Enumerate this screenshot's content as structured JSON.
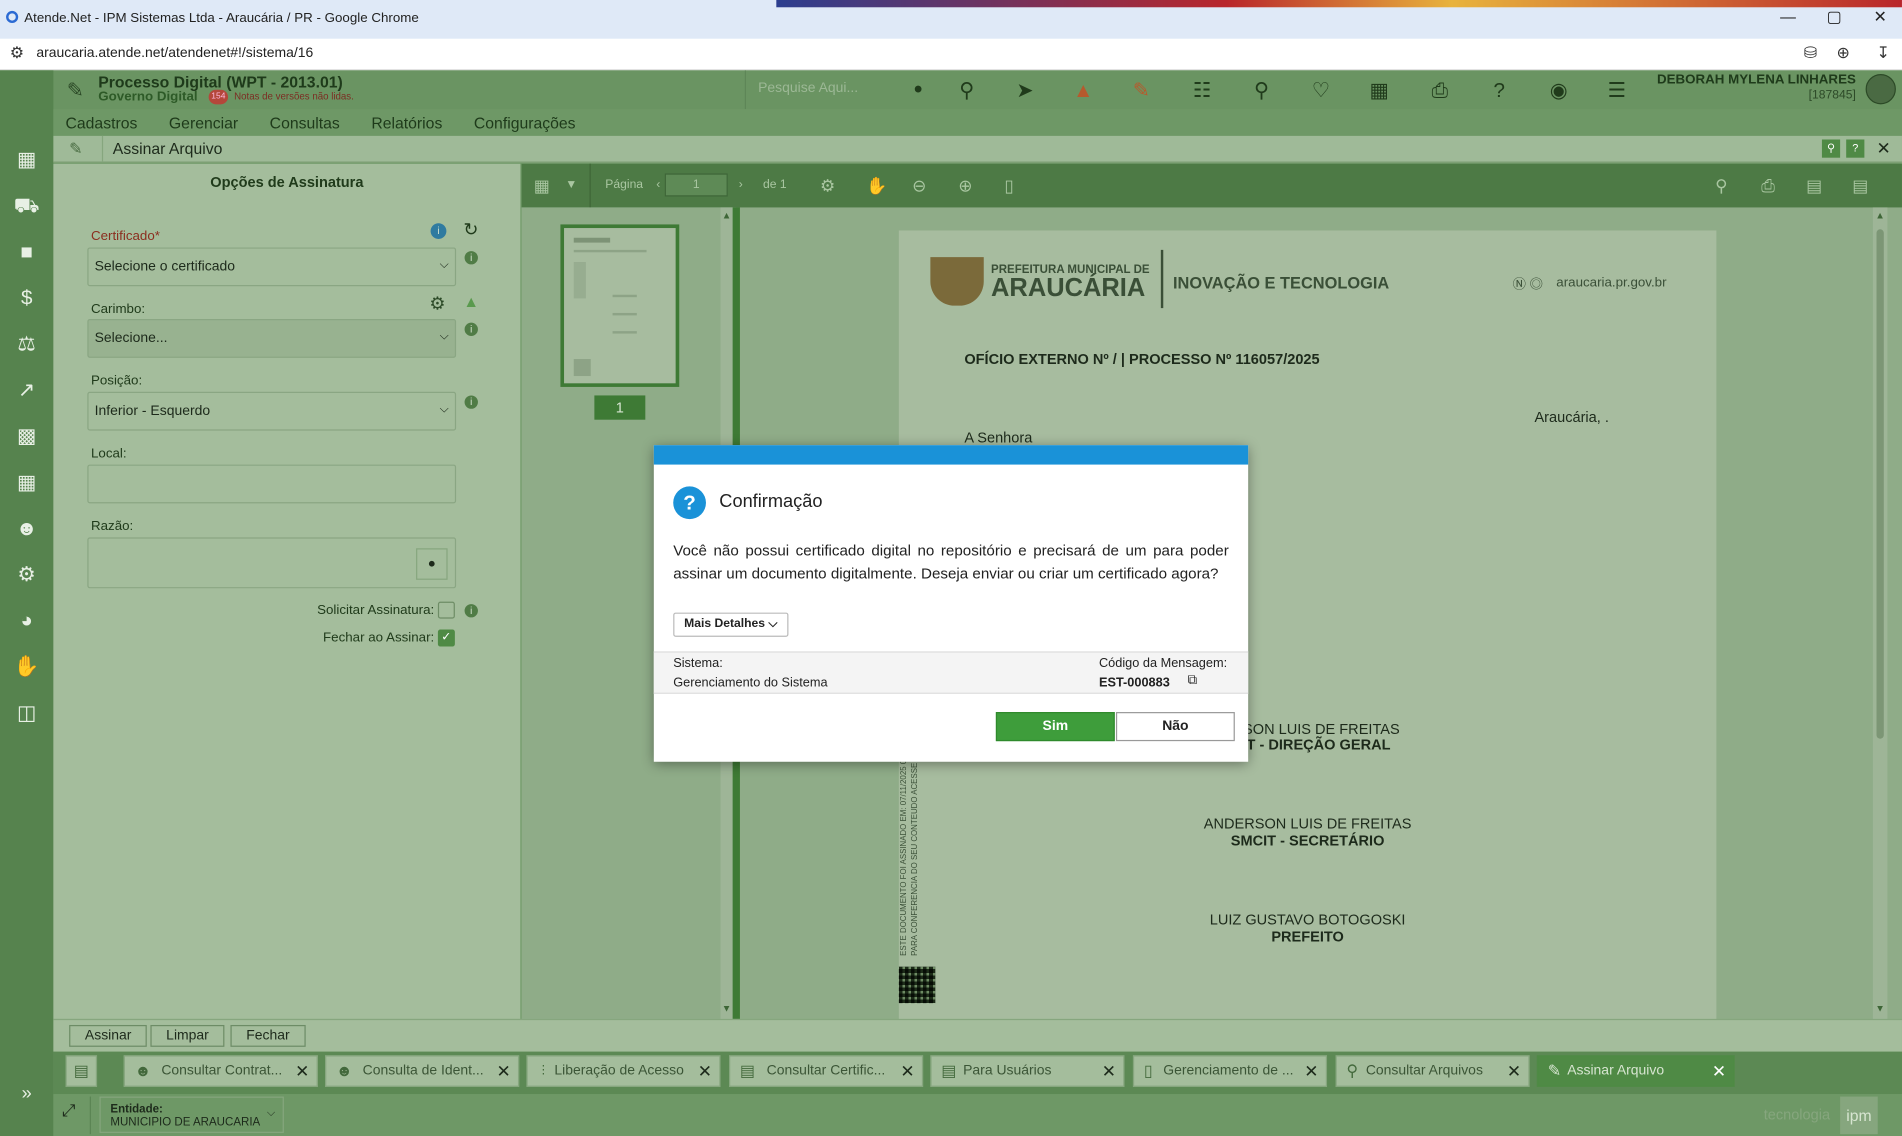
{
  "browser": {
    "title": "Atende.Net - IPM Sistemas Ltda - Araucária / PR - Google Chrome",
    "url": "araucaria.atende.net/atendenet#!/sistema/16"
  },
  "header": {
    "logo": "ipm",
    "app_title": "Processo Digital (WPT - 2013.01)",
    "app_subtitle": "Governo Digital",
    "notes_badge": "154",
    "notes_label": "Notas de versões não lidas.",
    "search_placeholder": "Pesquise Aqui...",
    "user_name": "DEBORAH MYLENA LINHARES",
    "user_id": "[187845]"
  },
  "menu": [
    "Cadastros",
    "Gerenciar",
    "Consultas",
    "Relatórios",
    "Configurações"
  ],
  "window": {
    "title": "Assinar Arquivo"
  },
  "sign_options": {
    "heading": "Opções de Assinatura",
    "certificado_label": "Certificado*",
    "certificado_value": "Selecione o certificado",
    "carimbo_label": "Carimbo:",
    "carimbo_value": "Selecione...",
    "posicao_label": "Posição:",
    "posicao_value": "Inferior - Esquerdo",
    "local_label": "Local:",
    "razao_label": "Razão:",
    "solicitar_label": "Solicitar Assinatura:",
    "solicitar_checked": false,
    "fechar_label": "Fechar ao Assinar:",
    "fechar_checked": true
  },
  "viewer": {
    "page_label": "Página",
    "page_value": "1",
    "page_total": "de 1",
    "thumb_number": "1"
  },
  "document": {
    "org_line1": "PREFEITURA MUNICIPAL DE",
    "org_line2": "ARAUCÁRIA",
    "dept": "INOVAÇÃO E TECNOLOGIA",
    "site": "araucaria.pr.gov.br",
    "heading": "OFÍCIO EXTERNO Nº / | PROCESSO Nº 116057/2025",
    "city_date": "Araucária, .",
    "salutation": "A Senhora",
    "sig1_name": "ERSON LUIS DE FREITAS",
    "sig1_role": "CIT - DIREÇÃO GERAL",
    "sig2_name": "ANDERSON LUIS DE FREITAS",
    "sig2_role": "SMCIT - SECRETÁRIO",
    "sig3_name": "LUIZ GUSTAVO BOTOGOSKI",
    "sig3_role": "PREFEITO",
    "side_note1": "ESTE DOCUMENTO FOI ASSINADO EM: 07/11/2025 09",
    "side_note2": "PARA CONFERÊNCIA DO SEU CONTEÚDO ACESSE"
  },
  "dialog": {
    "title": "Confirmação",
    "message": "Você não possui certificado digital no repositório e precisará de um para poder assinar um documento digitalmente. Deseja enviar ou criar um certificado agora?",
    "details_button": "Mais Detalhes",
    "sistema_label": "Sistema:",
    "sistema_value": "Gerenciamento do Sistema",
    "codigo_label": "Código da Mensagem:",
    "codigo_value": "EST-000883",
    "yes": "Sim",
    "no": "Não"
  },
  "bottom_buttons": [
    "Assinar",
    "Limpar",
    "Fechar"
  ],
  "tasks": [
    "Consultar Contrat...",
    "Consulta de Ident...",
    "Liberação de Acesso",
    "Consultar Certific...",
    "Para Usuários",
    "Gerenciamento de ...",
    "Consultar Arquivos",
    "Assinar Arquivo"
  ],
  "status": {
    "entity_label": "Entidade:",
    "entity_value": "MUNICIPIO DE ARAUCARIA",
    "brand": "tecnologia"
  },
  "colors": {
    "accent": "#1a92d8",
    "primary_green": "#3e9d3b",
    "app_green": "#6e9866"
  }
}
